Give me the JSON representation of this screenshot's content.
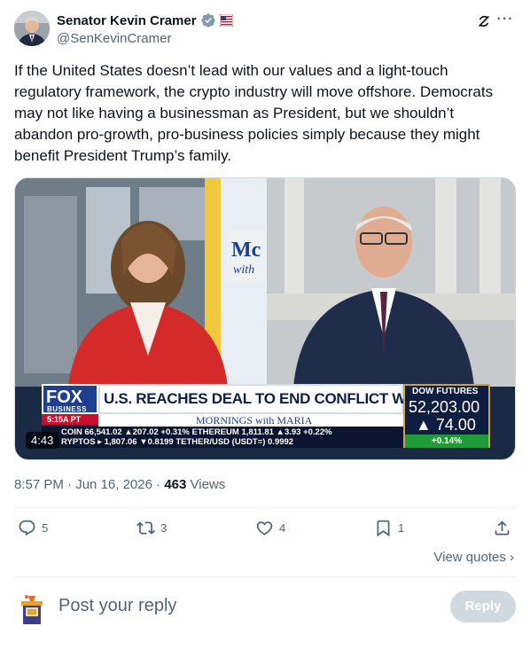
{
  "author": {
    "display_name": "Senator Kevin Cramer",
    "handle": "@SenKevinCramer"
  },
  "tweet": {
    "text": "If the United States doesn’t lead with our values and a light-touch regulatory framework, the crypto industry will move offshore. Democrats may not like having a businessman as President, but we shouldn’t abandon pro-growth, pro-business policies simply because they might benefit President Trump’s family."
  },
  "video": {
    "duration": "4:43",
    "network_logo": "FOX",
    "network_sub": "BUSINESS",
    "local_time": "5:15A PT",
    "headline": "U.S. REACHES DEAL TO END CONFLICT WITH IRAN",
    "show_name": "MORNINGS with MARIA",
    "show_logo_top": "Mc",
    "show_logo_sub": "with",
    "ticker_row1_label": "COIN",
    "ticker_row1": "66,541.02 ▲207.02 +0.31% ETHEREUM 1,811.81 ▲3.93 +0.22%",
    "ticker_row2_label": "RYPTOS",
    "ticker_row2": "▸ 1,807.06 ▼0.8199 TETHER/USD (USDT=) 0.9992",
    "dow_title": "DOW FUTURES",
    "dow_value": "52,203.00",
    "dow_change": "▲ 74.00",
    "dow_pct": "+0.14%"
  },
  "meta": {
    "time": "8:57 PM",
    "date": "Jun 16, 2026",
    "views_count": "463",
    "views_label": "Views"
  },
  "actions": {
    "replies": "5",
    "reposts": "3",
    "likes": "4",
    "bookmarks": "1"
  },
  "view_quotes": "View quotes ›",
  "reply": {
    "placeholder": "Post your reply",
    "button": "Reply"
  },
  "colors": {
    "verified": "#829aab",
    "reply_button_disabled": "#cfd9de",
    "secondary_text": "#536471"
  }
}
